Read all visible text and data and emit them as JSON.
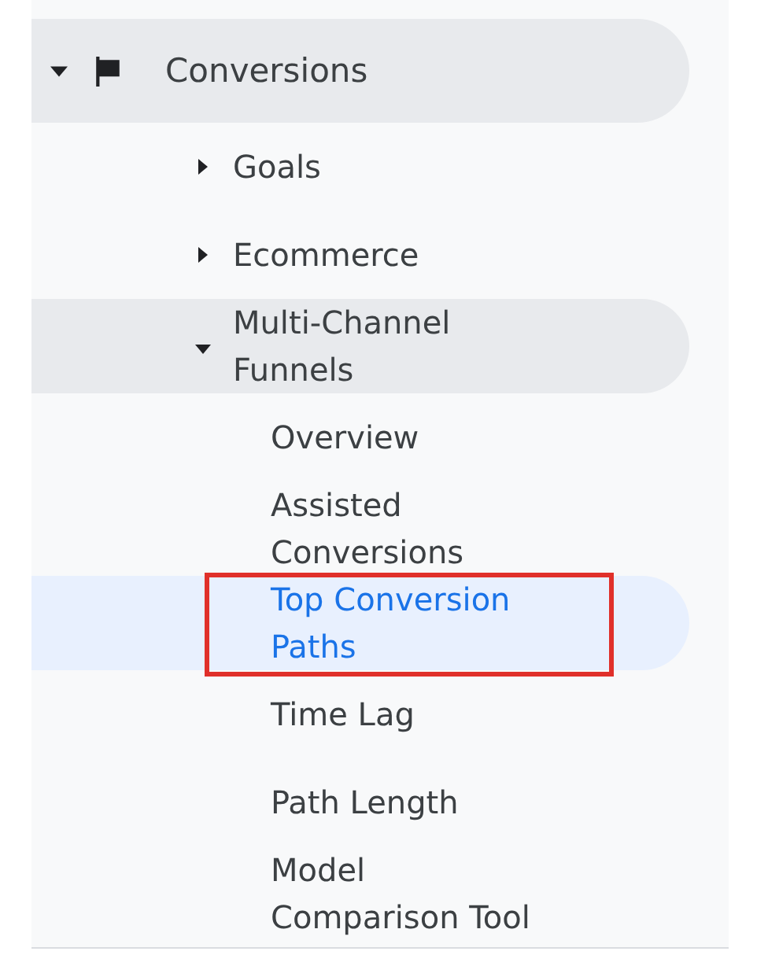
{
  "nav": [
    {
      "kind": "section",
      "label": "Conversions",
      "expanded": true,
      "selected": false,
      "children": [
        {
          "kind": "group",
          "label": "Goals",
          "expanded": false,
          "selected": false
        },
        {
          "kind": "group",
          "label": "Ecommerce",
          "expanded": false,
          "selected": false
        },
        {
          "kind": "group",
          "label": "Multi-Channel Funnels",
          "expanded": true,
          "selected": false,
          "children": [
            {
              "kind": "page",
              "label": "Overview",
              "selected": false,
              "annotated": false
            },
            {
              "kind": "page",
              "label": "Assisted Conversions",
              "selected": false,
              "annotated": false
            },
            {
              "kind": "page",
              "label": "Top Conversion Paths",
              "selected": true,
              "annotated": true
            },
            {
              "kind": "page",
              "label": "Time Lag",
              "selected": false,
              "annotated": false
            },
            {
              "kind": "page",
              "label": "Path Length",
              "selected": false,
              "annotated": false
            },
            {
              "kind": "page",
              "label": "Model Comparison Tool",
              "selected": false,
              "annotated": false
            }
          ]
        }
      ]
    }
  ]
}
